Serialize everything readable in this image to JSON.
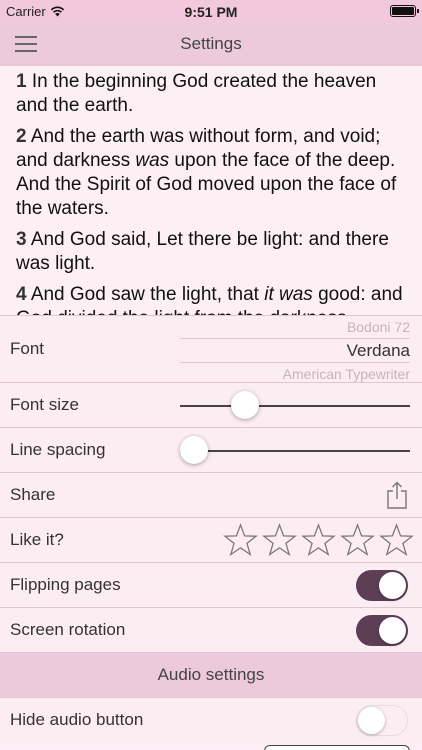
{
  "status": {
    "carrier": "Carrier",
    "time": "9:51 PM"
  },
  "nav": {
    "title": "Settings"
  },
  "verses": [
    {
      "num": "1",
      "parts": [
        {
          "t": "In the beginning God created the heaven and the earth."
        }
      ]
    },
    {
      "num": "2",
      "parts": [
        {
          "t": "And the earth was without form, and void; and darkness "
        },
        {
          "t": "was",
          "i": true
        },
        {
          "t": " upon the face of the deep. And the Spirit of God moved upon the face of the waters."
        }
      ]
    },
    {
      "num": "3",
      "parts": [
        {
          "t": "And God said, Let there be light: and there was light."
        }
      ]
    },
    {
      "num": "4",
      "parts": [
        {
          "t": "And God saw the light, that "
        },
        {
          "t": "it was",
          "i": true
        },
        {
          "t": " good: and God divided the light from the darkness."
        }
      ]
    }
  ],
  "settings": {
    "font": {
      "label": "Font",
      "prev": "Bodoni 72",
      "selected": "Verdana",
      "next": "American Typewriter"
    },
    "font_size": {
      "label": "Font size",
      "value": 0.25
    },
    "line_spacing": {
      "label": "Line spacing",
      "value": 0.0
    },
    "share": {
      "label": "Share",
      "icon": "share-icon"
    },
    "like": {
      "label": "Like it?",
      "stars": 5,
      "filled": 0
    },
    "flipping": {
      "label": "Flipping pages",
      "on": true
    },
    "rotation": {
      "label": "Screen rotation",
      "on": true
    },
    "audio_header": "Audio settings",
    "hide_audio": {
      "label": "Hide audio button",
      "on": false
    }
  },
  "colors": {
    "accent": "#5c3f55",
    "nav_bg": "#eccadb",
    "page_bg": "#fceef4"
  }
}
